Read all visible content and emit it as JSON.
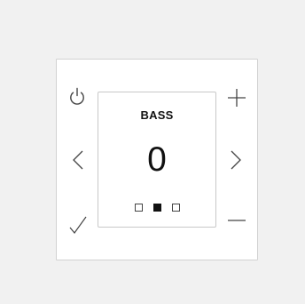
{
  "screen": {
    "title": "BASS",
    "value": "0",
    "pages": {
      "count": 3,
      "active_index": 1
    }
  },
  "buttons": {
    "power": "power-icon",
    "plus": "plus-icon",
    "left": "chevron-left-icon",
    "right": "chevron-right-icon",
    "confirm": "check-icon",
    "minus": "minus-icon"
  },
  "colors": {
    "background": "#f1f1f1",
    "panel": "#ffffff",
    "border": "#d2d2d2",
    "icon": "#444444",
    "text": "#111111"
  }
}
